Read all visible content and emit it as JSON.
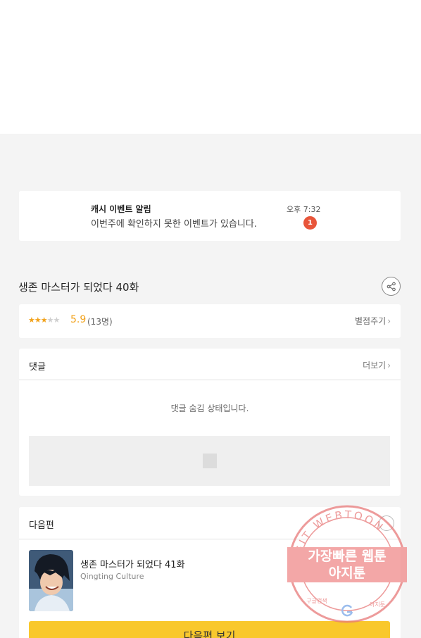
{
  "notice": {
    "title": "캐시 이벤트 알림",
    "message": "이번주에 확인하지 못한 이벤트가 있습니다.",
    "time": "오후 7:32",
    "badge": "1"
  },
  "episode": {
    "title": "생존 마스터가 되었다 40화",
    "share_icon": "share-icon"
  },
  "rating": {
    "stars_filled": 3,
    "stars_total": 5,
    "score": "5.9",
    "count": "(13명)",
    "rate_link": "별점주기"
  },
  "comments": {
    "label": "댓글",
    "more": "더보기",
    "hidden_message": "댓글 숨김 상태입니다."
  },
  "next_episode": {
    "label": "다음편",
    "title": "생존 마스터가 되었다 41화",
    "author": "Qingting Culture",
    "button": "다음편 보기"
  },
  "watermark": {
    "arc_text": "AGIT WEBTOON",
    "line1": "가장빠른 웹툰",
    "line2": "아지툰",
    "bottom_left": "구글검색",
    "bottom_right": "아지툰",
    "color": "#e87a7a"
  },
  "colors": {
    "accent": "#f9c82c",
    "star": "#f2a21b",
    "badge": "#e8553a"
  }
}
